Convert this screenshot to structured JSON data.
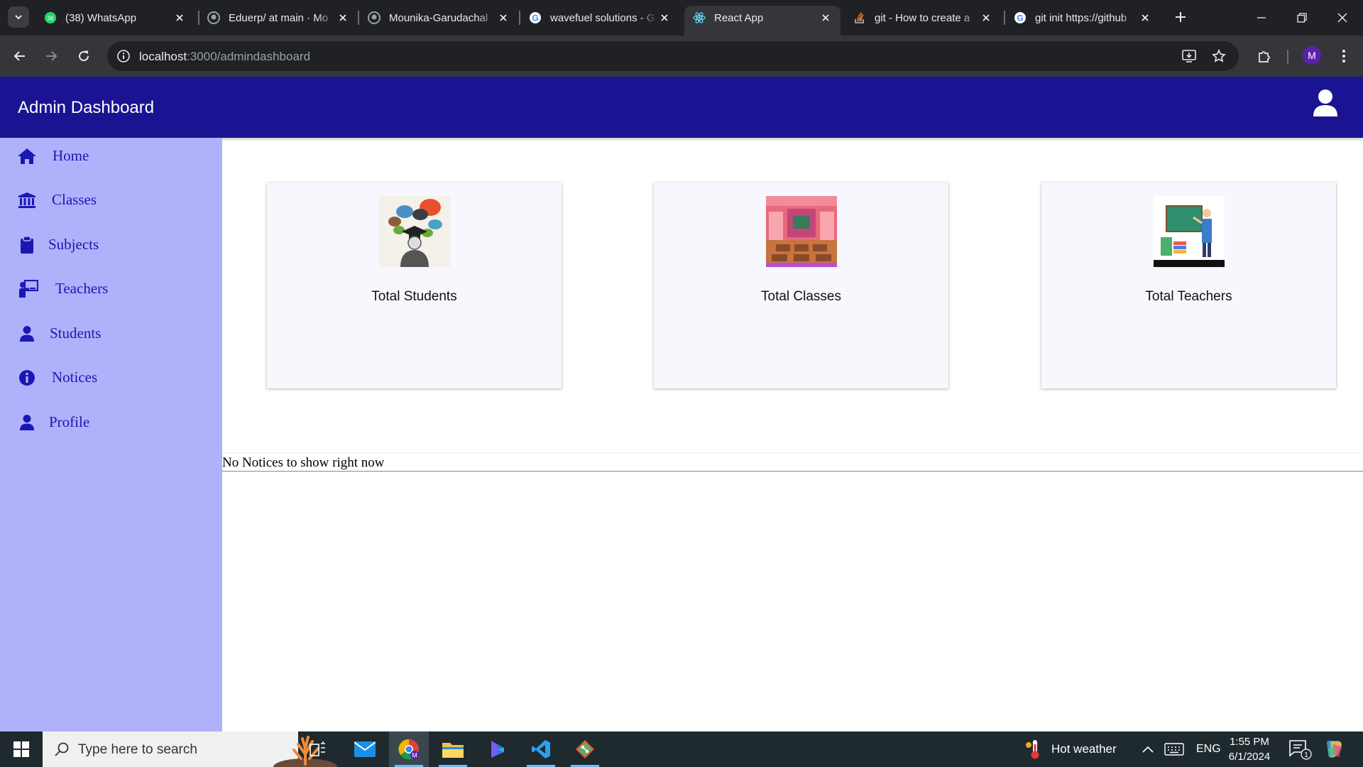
{
  "browser": {
    "tabs": [
      {
        "title": "(38) WhatsApp",
        "favicon": "whatsapp-icon"
      },
      {
        "title": "Eduerp/ at main · Mo",
        "favicon": "github-icon"
      },
      {
        "title": "Mounika-Garudachal",
        "favicon": "github-icon"
      },
      {
        "title": "wavefuel solutions - G",
        "favicon": "google-icon"
      },
      {
        "title": "React App",
        "favicon": "react-icon",
        "active": true
      },
      {
        "title": "git - How to create a",
        "favicon": "stackoverflow-icon"
      },
      {
        "title": "git init https://github",
        "favicon": "google-icon"
      }
    ],
    "whatsapp_badge": "38",
    "url_host": "localhost",
    "url_path": ":3000/admindashboard",
    "profile_initial": "M"
  },
  "app": {
    "title": "Admin Dashboard",
    "sidebar": [
      {
        "label": "Home",
        "icon": "home-icon"
      },
      {
        "label": "Classes",
        "icon": "bank-icon"
      },
      {
        "label": "Subjects",
        "icon": "clipboard-icon"
      },
      {
        "label": "Teachers",
        "icon": "teacher-icon"
      },
      {
        "label": "Students",
        "icon": "person-icon"
      },
      {
        "label": "Notices",
        "icon": "info-icon"
      },
      {
        "label": "Profile",
        "icon": "person-icon"
      }
    ],
    "cards": [
      {
        "title": "Total Students",
        "image": "students-illustration"
      },
      {
        "title": "Total Classes",
        "image": "classroom-illustration"
      },
      {
        "title": "Total Teachers",
        "image": "teacher-illustration"
      }
    ],
    "notice_text": "No Notices to show right now"
  },
  "colors": {
    "appbar": "#1a1392",
    "sidebar": "#b0b1fb",
    "nav_text": "#1b17b4",
    "card_bg": "#f7f8fd"
  },
  "taskbar": {
    "search_placeholder": "Type here to search",
    "weather": "Hot weather",
    "language": "ENG",
    "time": "1:55 PM",
    "date": "6/1/2024",
    "notification_count": "1"
  }
}
